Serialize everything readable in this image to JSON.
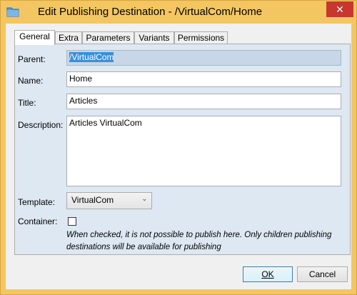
{
  "window": {
    "title": "Edit Publishing Destination - /VirtualCom/Home",
    "close_glyph": "✕"
  },
  "tabs": [
    {
      "label": "General",
      "active": true
    },
    {
      "label": "Extra",
      "active": false
    },
    {
      "label": "Parameters",
      "active": false
    },
    {
      "label": "Variants",
      "active": false
    },
    {
      "label": "Permissions",
      "active": false
    }
  ],
  "form": {
    "parent": {
      "label": "Parent:",
      "value": "/VirtualCom"
    },
    "name": {
      "label": "Name:",
      "value": "Home"
    },
    "title": {
      "label": "Title:",
      "value": "Articles"
    },
    "description": {
      "label": "Description:",
      "value": "Articles VirtualCom"
    },
    "template": {
      "label": "Template:",
      "value": "VirtualCom"
    },
    "container": {
      "label": "Container:",
      "checked": false,
      "hint": "When checked, it is not possible to publish here. Only children publishing destinations will be available for publishing"
    }
  },
  "buttons": {
    "ok_label": "OK",
    "cancel_label": "Cancel"
  },
  "colors": {
    "titlebar": "#f4c662",
    "panel": "#dde8f3",
    "readonly_field": "#c8d7e7",
    "selection": "#3a8fd9",
    "close_button": "#c7372f"
  },
  "icons": {
    "app": "folder-icon",
    "close": "close-icon",
    "dropdown": "chevron-down-icon"
  }
}
